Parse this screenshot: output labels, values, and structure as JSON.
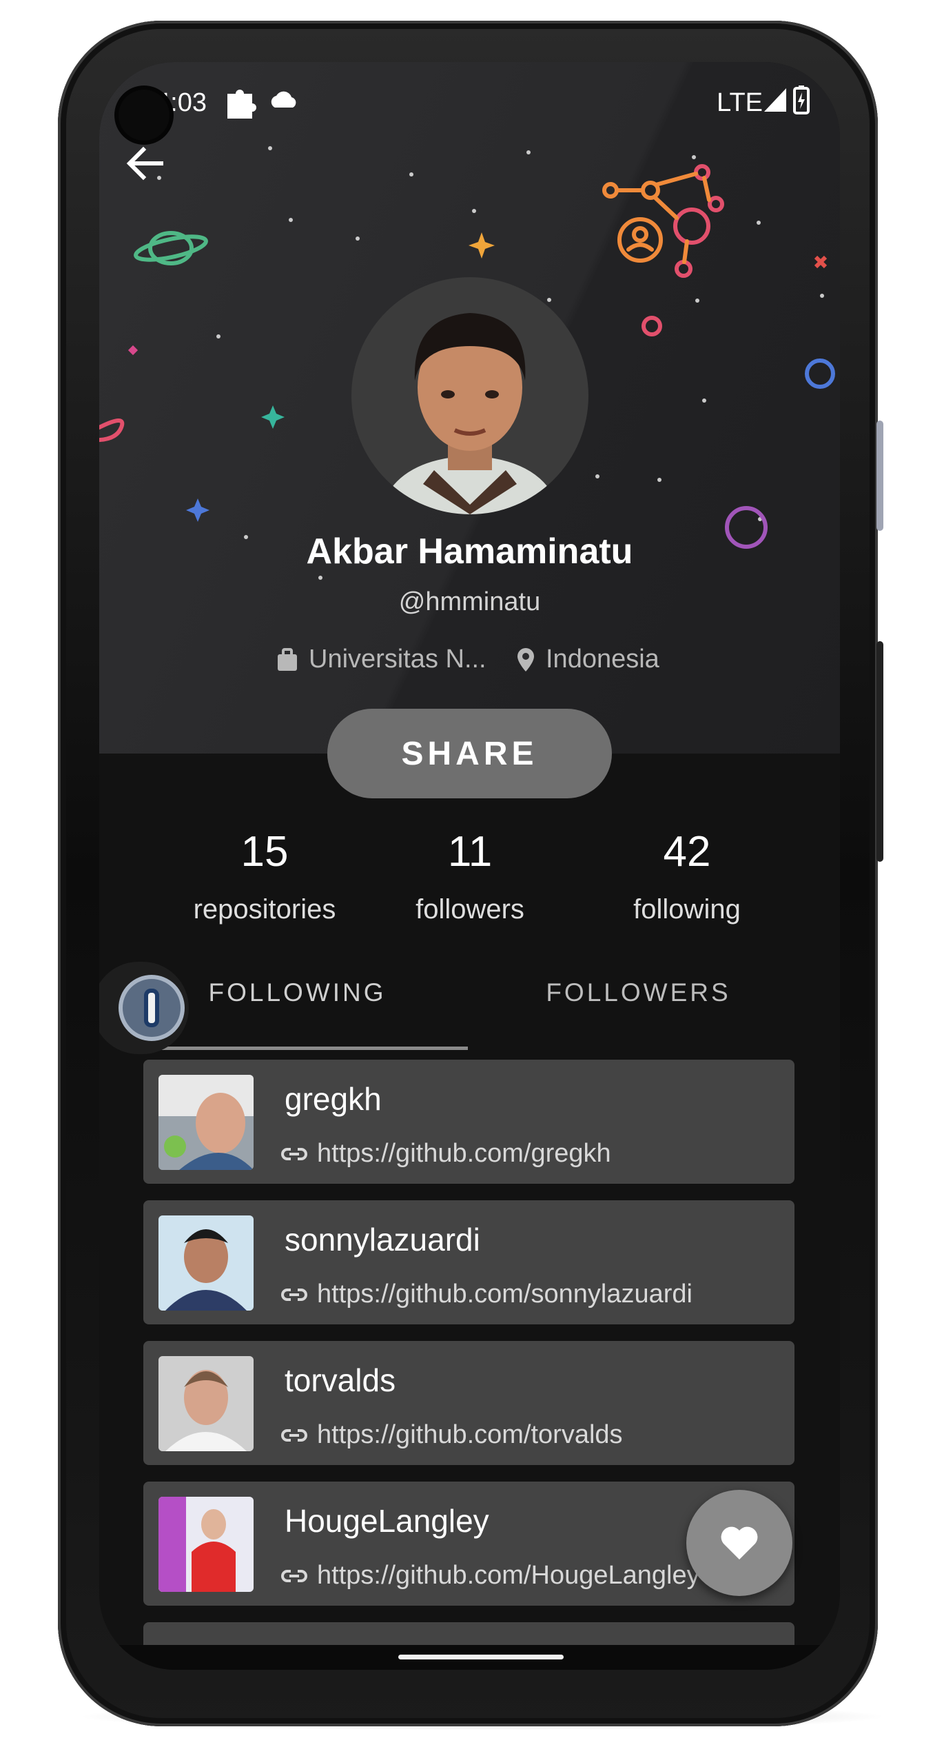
{
  "status_bar": {
    "time": "4:03",
    "network": "LTE"
  },
  "profile": {
    "name": "Akbar Hamaminatu",
    "username": "@hmminatu",
    "company": "Universitas N...",
    "location": "Indonesia",
    "share_label": "SHARE"
  },
  "stats": [
    {
      "value": "15",
      "label": "repositories"
    },
    {
      "value": "11",
      "label": "followers"
    },
    {
      "value": "42",
      "label": "following"
    }
  ],
  "tabs": [
    {
      "label": "FOLLOWING",
      "active": true
    },
    {
      "label": "FOLLOWERS",
      "active": false
    }
  ],
  "users": [
    {
      "login": "gregkh",
      "url": "https://github.com/gregkh"
    },
    {
      "login": "sonnylazuardi",
      "url": "https://github.com/sonnylazuardi"
    },
    {
      "login": "torvalds",
      "url": "https://github.com/torvalds"
    },
    {
      "login": "HougeLangley",
      "url": "https://github.com/HougeLangley"
    }
  ],
  "icons": {
    "back": "arrow-left-icon",
    "company": "briefcase-icon",
    "location": "map-pin-icon",
    "link": "link-icon",
    "fab": "heart-icon"
  },
  "colors": {
    "background": "#121212",
    "header": "#2b2b2d",
    "card": "#444444",
    "share_button": "#6f6f6f",
    "fab": "#8a8a8a"
  }
}
